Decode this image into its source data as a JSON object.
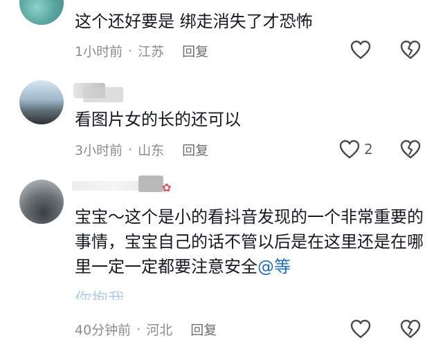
{
  "comments": [
    {
      "text": "这个还好要是 绑走消失了才恐怖",
      "time": "1小时前",
      "location": "江苏",
      "reply_label": "回复",
      "like_count": "",
      "like_icon": "heart-icon",
      "dislike_icon": "broken-heart-icon"
    },
    {
      "text": "看图片女的长的还可以",
      "time": "3小时前",
      "location": "山东",
      "reply_label": "回复",
      "like_count": "2",
      "like_icon": "heart-icon",
      "dislike_icon": "broken-heart-icon"
    },
    {
      "text_main": "宝宝～这个是小的看抖音发现的一个非常重要的事情，宝宝自己的话不管以后是在这里还是在哪里一定一定都要注意安全",
      "mention": "@等",
      "text_trailing": "你抱我",
      "time": "40分钟前",
      "location": "河北",
      "reply_label": "回复",
      "like_count": "",
      "like_icon": "heart-icon",
      "dislike_icon": "broken-heart-icon"
    }
  ],
  "meta_separator": "·",
  "colors": {
    "text": "#161823",
    "meta": "#8a8b91",
    "mention": "#1f6fbf",
    "background": "#ffffff"
  }
}
